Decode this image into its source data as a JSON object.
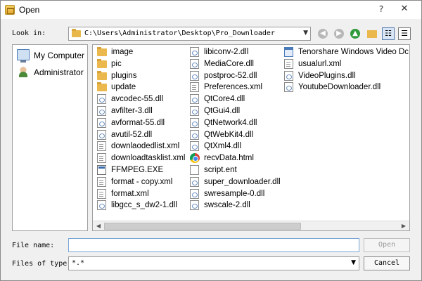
{
  "window": {
    "title": "Open",
    "help_glyph": "?",
    "close_glyph": "✕"
  },
  "toolbar": {
    "look_in_label": "Look in:",
    "path": "C:\\Users\\Administrator\\Desktop\\Pro_Downloader",
    "dropdown_glyph": "▼",
    "back_glyph": "◀",
    "forward_glyph": "▶",
    "up_glyph": "▲",
    "list_view_glyph": "☷",
    "detail_view_glyph": "☰"
  },
  "sidebar": {
    "items": [
      {
        "label": "My Computer",
        "icon": "computer-icon"
      },
      {
        "label": "Administrator",
        "icon": "user-icon"
      }
    ]
  },
  "files": {
    "columns": [
      [
        {
          "name": "image",
          "icon": "folder"
        },
        {
          "name": "pic",
          "icon": "folder"
        },
        {
          "name": "plugins",
          "icon": "folder"
        },
        {
          "name": "update",
          "icon": "folder"
        },
        {
          "name": "avcodec-55.dll",
          "icon": "dll"
        },
        {
          "name": "avfilter-3.dll",
          "icon": "dll"
        },
        {
          "name": "avformat-55.dll",
          "icon": "dll"
        },
        {
          "name": "avutil-52.dll",
          "icon": "dll"
        },
        {
          "name": "downlaodedlist.xml",
          "icon": "xml"
        },
        {
          "name": "downloadtasklist.xml",
          "icon": "xml"
        },
        {
          "name": "FFMPEG.EXE",
          "icon": "exe"
        },
        {
          "name": "format - copy.xml",
          "icon": "xml"
        },
        {
          "name": "format.xml",
          "icon": "xml"
        },
        {
          "name": "libgcc_s_dw2-1.dll",
          "icon": "dll"
        }
      ],
      [
        {
          "name": "libiconv-2.dll",
          "icon": "dll"
        },
        {
          "name": "MediaCore.dll",
          "icon": "dll"
        },
        {
          "name": "postproc-52.dll",
          "icon": "dll"
        },
        {
          "name": "Preferences.xml",
          "icon": "xml"
        },
        {
          "name": "QtCore4.dll",
          "icon": "dll"
        },
        {
          "name": "QtGui4.dll",
          "icon": "dll"
        },
        {
          "name": "QtNetwork4.dll",
          "icon": "dll"
        },
        {
          "name": "QtWebKit4.dll",
          "icon": "dll"
        },
        {
          "name": "QtXml4.dll",
          "icon": "dll"
        },
        {
          "name": "recvData.html",
          "icon": "chrome"
        },
        {
          "name": "script.ent",
          "icon": "blank"
        },
        {
          "name": "super_downloader.dll",
          "icon": "dll"
        },
        {
          "name": "swresample-0.dll",
          "icon": "dll"
        },
        {
          "name": "swscale-2.dll",
          "icon": "dll"
        }
      ],
      [
        {
          "name": "Tenorshare Windows Video Dc",
          "icon": "app"
        },
        {
          "name": "usualurl.xml",
          "icon": "xml"
        },
        {
          "name": "VideoPlugins.dll",
          "icon": "dll"
        },
        {
          "name": "YoutubeDownloader.dll",
          "icon": "dll"
        }
      ]
    ]
  },
  "footer": {
    "file_name_label": "File name:",
    "file_name_value": "",
    "open_label": "Open",
    "files_of_type_label": "Files of type:",
    "files_of_type_value": "*.*",
    "cancel_label": "Cancel"
  },
  "scrollbar": {
    "left_glyph": "◀",
    "right_glyph": "▶"
  }
}
